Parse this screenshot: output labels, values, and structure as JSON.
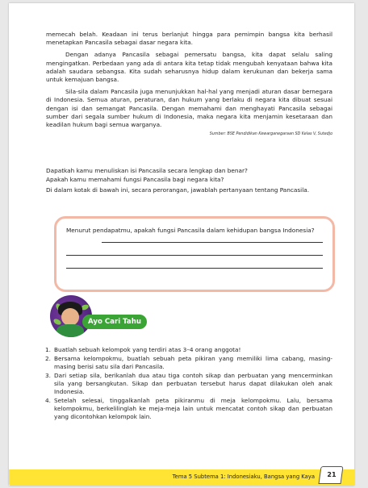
{
  "intro_paragraphs": {
    "p1": "memecah belah. Keadaan ini terus berlanjut hingga para pemimpin bangsa kita berhasil menetapkan Pancasila sebagai dasar negara kita.",
    "p2": "Dengan adanya Pancasila sebagai pemersatu bangsa, kita dapat selalu saling mengingatkan. Perbedaan yang ada di antara kita tetap tidak mengubah kenyataan bahwa kita adalah saudara sebangsa. Kita sudah seharusnya hidup dalam kerukunan dan bekerja sama untuk kemajuan bangsa.",
    "p3": "Sila-sila dalam Pancasila juga menunjukkan hal-hal yang menjadi aturan dasar bernegara di Indonesia. Semua aturan, peraturan, dan hukum yang berlaku di negara kita dibuat sesuai dengan isi dan semangat Pancasila. Dengan memahami dan menghayati Pancasila sebagai sumber dari segala sumber hukum di Indonesia, maka negara kita menjamin kesetaraan dan keadilan hukum bagi semua warganya.",
    "source": "Sumber: BSE Pendidikan Kewarganegaraan SD Kelas V, Sutedjo"
  },
  "questions": {
    "q1": "Dapatkah kamu menuliskan isi Pancasila secara lengkap dan benar?",
    "q2": "Apakah kamu memahami fungsi Pancasila bagi negara kita?",
    "instruction": "Di dalam kotak di bawah ini, secara perorangan, jawablah pertanyaan tentang Pancasila."
  },
  "answer_box": {
    "prompt": "Menurut pendapatmu, apakah fungsi Pancasila dalam kehidupan bangsa Indonesia?"
  },
  "section": {
    "label": "Ayo Cari Tahu"
  },
  "steps": [
    {
      "num": "1.",
      "text": "Buatlah sebuah kelompok yang terdiri atas 3–4 orang anggota!"
    },
    {
      "num": "2.",
      "text": "Bersama kelompokmu, buatlah sebuah peta pikiran yang memiliki lima cabang, masing-masing berisi satu sila dari Pancasila."
    },
    {
      "num": "3.",
      "text": "Dari setiap sila, berikanlah dua atau tiga contoh sikap dan perbuatan yang mencerminkan sila yang bersangkutan. Sikap dan perbuatan tersebut harus dapat dilakukan oleh anak Indonesia."
    },
    {
      "num": "4.",
      "text": "Setelah selesai, tinggalkanlah peta pikiranmu di meja kelompokmu. Lalu, bersama kelompokmu, berkelilinglah ke meja-meja lain untuk mencatat contoh sikap dan perbuatan yang dicontohkan kelompok lain."
    }
  ],
  "footer": {
    "title": "Tema 5 Subtema 1: Indonesiaku, Bangsa yang Kaya",
    "page_number": "21"
  },
  "colors": {
    "footer_yellow": "#ffe433",
    "box_border": "#f4b9a6",
    "section_green": "#3aa535"
  }
}
